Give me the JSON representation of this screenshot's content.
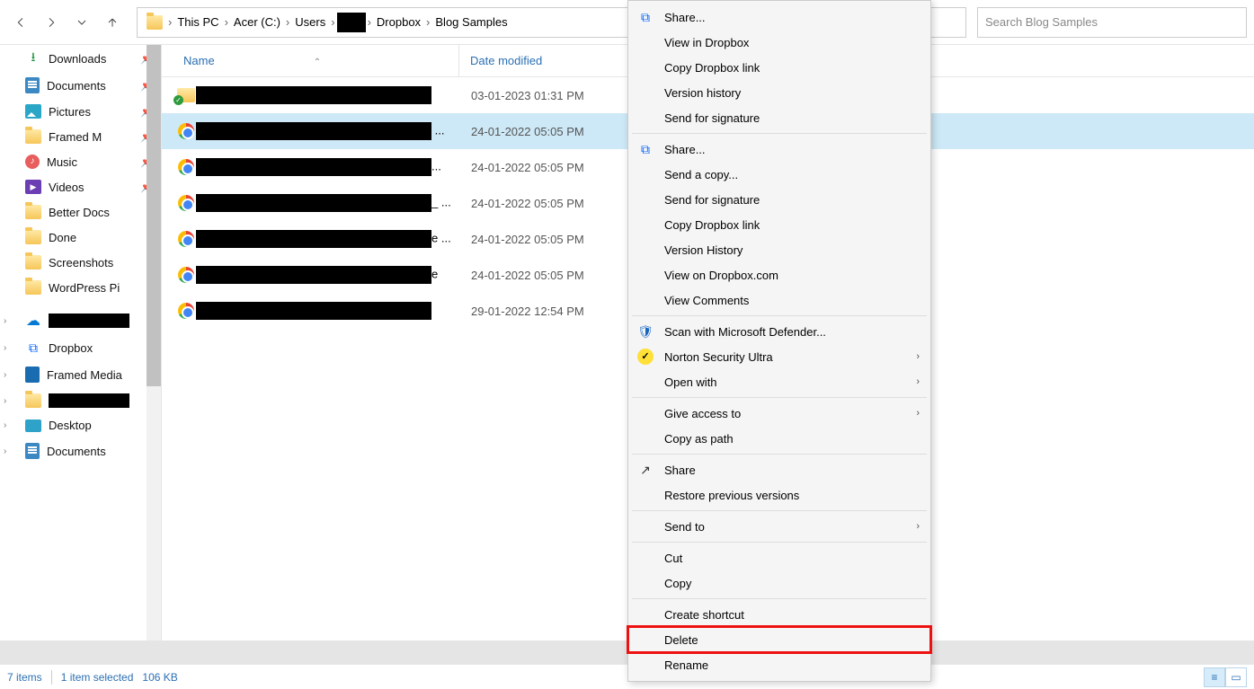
{
  "toolbar": {
    "breadcrumbs": [
      "This PC",
      "Acer (C:)",
      "Users",
      "",
      "Dropbox",
      "Blog Samples"
    ],
    "search_placeholder": "Search Blog Samples"
  },
  "sidebar": {
    "quick": [
      {
        "label": "Downloads",
        "icon": "download"
      },
      {
        "label": "Documents",
        "icon": "doc"
      },
      {
        "label": "Pictures",
        "icon": "pic"
      },
      {
        "label": "Framed M",
        "icon": "folder"
      },
      {
        "label": "Music",
        "icon": "music"
      },
      {
        "label": "Videos",
        "icon": "vid"
      },
      {
        "label": "Better Docs",
        "icon": "folder"
      },
      {
        "label": "Done",
        "icon": "folder"
      },
      {
        "label": "Screenshots",
        "icon": "folder"
      },
      {
        "label": "WordPress Pi",
        "icon": "folder"
      }
    ],
    "roots": [
      {
        "label": "",
        "icon": "onedrive",
        "redacted": true
      },
      {
        "label": "Dropbox",
        "icon": "dropbox"
      },
      {
        "label": "Framed Media",
        "icon": "blue"
      },
      {
        "label": "",
        "icon": "folder",
        "redacted": true
      },
      {
        "label": "Desktop",
        "icon": "desktop"
      },
      {
        "label": "Documents",
        "icon": "doc"
      }
    ]
  },
  "columns": {
    "name": "Name",
    "date": "Date modified"
  },
  "rows": [
    {
      "icon": "folder",
      "date": "03-01-2023 01:31 PM",
      "selected": false
    },
    {
      "icon": "chrome",
      "date": "24-01-2022 05:05 PM",
      "selected": true,
      "trail": " ..."
    },
    {
      "icon": "chrome",
      "date": "24-01-2022 05:05 PM",
      "selected": false,
      "trail": "..."
    },
    {
      "icon": "chrome",
      "date": "24-01-2022 05:05 PM",
      "selected": false,
      "trail": "_ ..."
    },
    {
      "icon": "chrome",
      "date": "24-01-2022 05:05 PM",
      "selected": false,
      "trail": "e ..."
    },
    {
      "icon": "chrome",
      "date": "24-01-2022 05:05 PM",
      "selected": false,
      "trail": "e"
    },
    {
      "icon": "chrome",
      "date": "29-01-2022 12:54 PM",
      "selected": false,
      "trail": ""
    }
  ],
  "context_menu": {
    "groups": [
      [
        {
          "label": "Share...",
          "icon": "dropbox"
        },
        {
          "label": "View in Dropbox"
        },
        {
          "label": "Copy Dropbox link"
        },
        {
          "label": "Version history"
        },
        {
          "label": "Send for signature"
        }
      ],
      [
        {
          "label": "Share...",
          "icon": "dropbox"
        },
        {
          "label": "Send a copy..."
        },
        {
          "label": "Send for signature"
        },
        {
          "label": "Copy Dropbox link"
        },
        {
          "label": "Version History"
        },
        {
          "label": "View on Dropbox.com"
        },
        {
          "label": "View Comments"
        }
      ],
      [
        {
          "label": "Scan with Microsoft Defender...",
          "icon": "shield"
        },
        {
          "label": "Norton Security Ultra",
          "icon": "norton",
          "submenu": true
        },
        {
          "label": "Open with",
          "submenu": true
        }
      ],
      [
        {
          "label": "Give access to",
          "submenu": true
        },
        {
          "label": "Copy as path"
        }
      ],
      [
        {
          "label": "Share",
          "icon": "sharearrow"
        },
        {
          "label": "Restore previous versions"
        }
      ],
      [
        {
          "label": "Send to",
          "submenu": true
        }
      ],
      [
        {
          "label": "Cut"
        },
        {
          "label": "Copy"
        }
      ],
      [
        {
          "label": "Create shortcut"
        },
        {
          "label": "Delete",
          "highlight": true
        },
        {
          "label": "Rename"
        }
      ]
    ]
  },
  "status": {
    "items": "7 items",
    "selected": "1 item selected",
    "size": "106 KB"
  }
}
